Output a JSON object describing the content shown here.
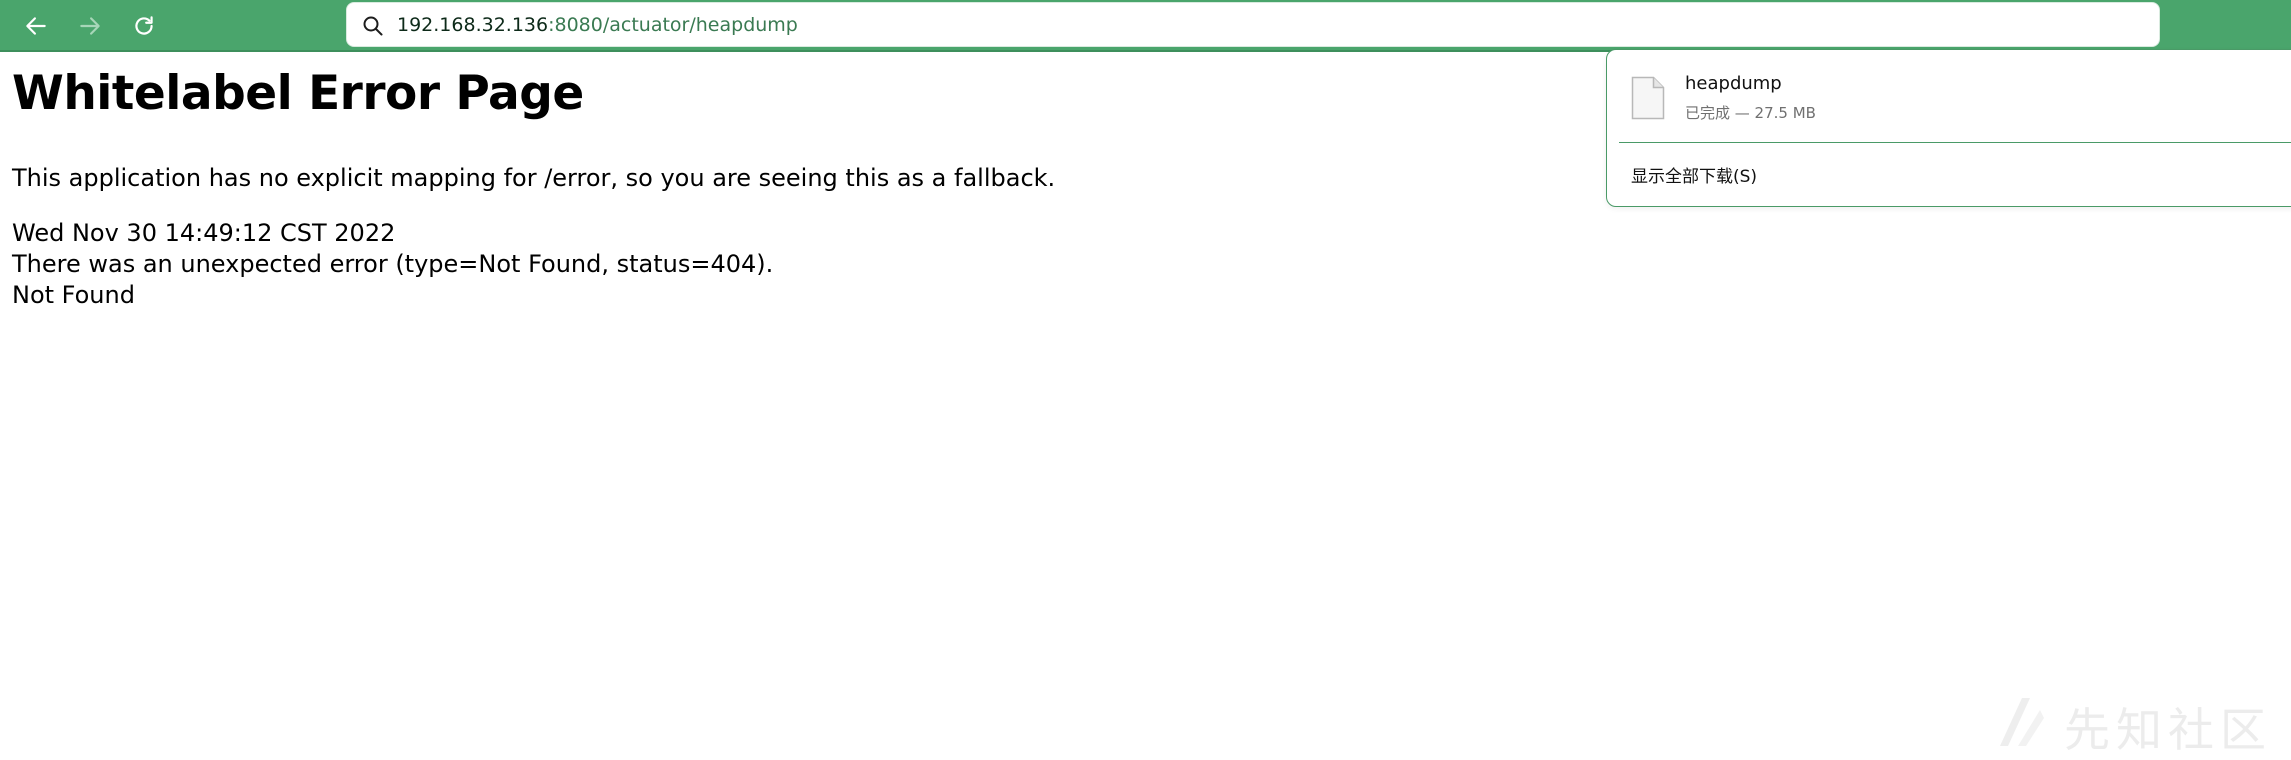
{
  "colors": {
    "toolbar": "#4aa56c",
    "accent_border": "#4a9a67"
  },
  "browser": {
    "address_bar": {
      "host": "192.168.32.136",
      "rest": ":8080/actuator/heapdump"
    },
    "nav": {
      "back_icon": "arrow-left-icon",
      "forward_icon": "arrow-right-icon",
      "reload_icon": "reload-icon",
      "search_icon": "search-icon"
    }
  },
  "page": {
    "title": "Whitelabel Error Page",
    "message": "This application has no explicit mapping for /error, so you are seeing this as a fallback.",
    "timestamp": "Wed Nov 30 14:49:12 CST 2022",
    "error_line": "There was an unexpected error (type=Not Found, status=404).",
    "error_reason": "Not Found"
  },
  "downloads": {
    "items": [
      {
        "name": "heapdump",
        "status": "已完成 — 27.5 MB",
        "icon": "file-icon"
      }
    ],
    "show_all": "显示全部下载(S)"
  },
  "watermark": {
    "text": "先知社区"
  }
}
